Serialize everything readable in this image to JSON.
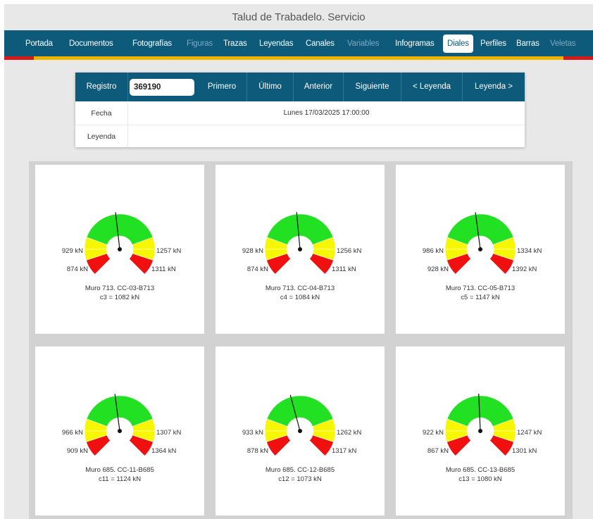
{
  "app": {
    "title": "Talud de Trabadelo. Servicio"
  },
  "nav": {
    "items": [
      {
        "label": "Portada",
        "state": "normal"
      },
      {
        "label": "Documentos",
        "state": "normal"
      },
      {
        "label": "Fotografías",
        "state": "normal"
      },
      {
        "label": "Figuras",
        "state": "disabled"
      },
      {
        "label": "Trazas",
        "state": "normal"
      },
      {
        "label": "Leyendas",
        "state": "normal"
      },
      {
        "label": "Canales",
        "state": "normal"
      },
      {
        "label": "Variables",
        "state": "disabled"
      },
      {
        "label": "Infogramas",
        "state": "normal"
      },
      {
        "label": "Diales",
        "state": "active"
      },
      {
        "label": "Perfiles",
        "state": "normal"
      },
      {
        "label": "Barras",
        "state": "normal"
      },
      {
        "label": "Veletas",
        "state": "disabled"
      }
    ]
  },
  "colors": {
    "nav_bg": "#0e5a7a",
    "accent_stripe": "#f0b400",
    "stripe_ends": "#d61a1a",
    "gauge_green": "#22e022",
    "gauge_yellow": "#f7f700",
    "gauge_red": "#f01010"
  },
  "record": {
    "registro_label": "Registro",
    "registro_value": "369190",
    "buttons": {
      "first": "Primero",
      "last": "Último",
      "previous": "Anterior",
      "next": "Siguiente",
      "legend_prev": "< Leyenda",
      "legend_next": "Leyenda >"
    },
    "fecha_label": "Fecha",
    "fecha_value": "Lunes 17/03/2025 17:00:00",
    "leyenda_label": "Leyenda",
    "leyenda_value": ""
  },
  "dials": [
    {
      "yellow_low": "929 kN",
      "red_low": "874 kN",
      "yellow_high": "1257 kN",
      "red_high": "1311 kN",
      "name": "Muro 713. CC-03-B713",
      "reading": "c3 = 1082 kN",
      "value": 1082,
      "min": 874,
      "max": 1311
    },
    {
      "yellow_low": "928 kN",
      "red_low": "874 kN",
      "yellow_high": "1256 kN",
      "red_high": "1311 kN",
      "name": "Muro 713. CC-04-B713",
      "reading": "c4 = 1084 kN",
      "value": 1084,
      "min": 874,
      "max": 1311
    },
    {
      "yellow_low": "986 kN",
      "red_low": "928 kN",
      "yellow_high": "1334 kN",
      "red_high": "1392 kN",
      "name": "Muro 713. CC-05-B713",
      "reading": "c5 = 1147 kN",
      "value": 1147,
      "min": 928,
      "max": 1392
    },
    {
      "yellow_low": "966 kN",
      "red_low": "909 kN",
      "yellow_high": "1307 kN",
      "red_high": "1364 kN",
      "name": "Muro 685. CC-11-B685",
      "reading": "c11 = 1124 kN",
      "value": 1124,
      "min": 909,
      "max": 1364
    },
    {
      "yellow_low": "933 kN",
      "red_low": "878 kN",
      "yellow_high": "1262 kN",
      "red_high": "1317 kN",
      "name": "Muro 685. CC-12-B685",
      "reading": "c12 = 1073 kN",
      "value": 1073,
      "min": 878,
      "max": 1317
    },
    {
      "yellow_low": "922 kN",
      "red_low": "867 kN",
      "yellow_high": "1247 kN",
      "red_high": "1301 kN",
      "name": "Muro 685. CC-13-B685",
      "reading": "c13 = 1080 kN",
      "value": 1080,
      "min": 867,
      "max": 1301
    }
  ]
}
